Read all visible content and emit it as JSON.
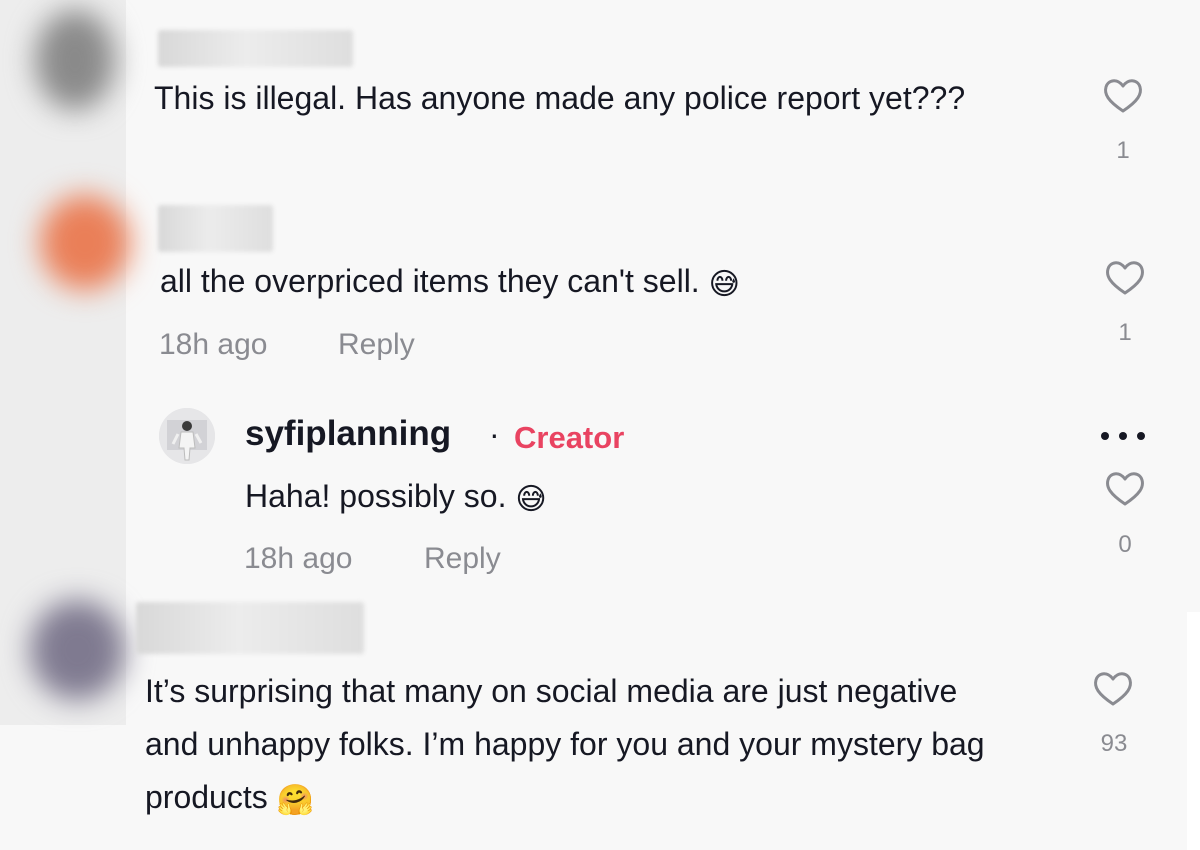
{
  "comments": [
    {
      "text": "This is illegal. Has anyone made any police report yet???",
      "likes": "1"
    },
    {
      "text": "all the overpriced items they can't sell.",
      "emoji": "😅",
      "time": "18h ago",
      "reply_label": "Reply",
      "likes": "1"
    },
    {
      "username": "syfiplanning",
      "separator": "·",
      "badge": "Creator",
      "text": "Haha! possibly so.",
      "emoji": "😅",
      "time": "18h ago",
      "reply_label": "Reply",
      "likes": "0"
    },
    {
      "text": "It’s surprising that many on social media are just negative and unhappy folks. I’m happy for you and your mystery bag products",
      "emoji": "🤗",
      "likes": "93"
    }
  ],
  "icons": {
    "like": "heart-outline-icon",
    "more": "more-dots-icon"
  },
  "colors": {
    "creator_badge": "#e94361",
    "meta_text": "#8a8b91",
    "primary_text": "#161823"
  }
}
